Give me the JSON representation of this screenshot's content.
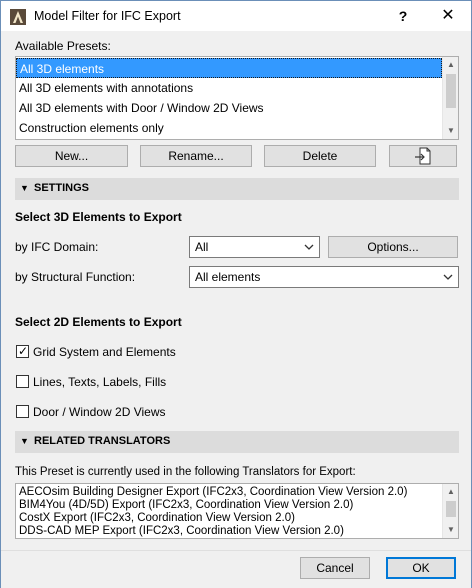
{
  "window": {
    "title": "Model Filter for IFC Export",
    "help_label": "?",
    "close_label": "✕"
  },
  "presets": {
    "label": "Available Presets:",
    "items": [
      "All 3D elements",
      "All 3D elements with annotations",
      "All 3D elements with Door / Window 2D Views",
      "Construction elements only"
    ],
    "selected_index": 0,
    "buttons": {
      "new": "New...",
      "rename": "Rename...",
      "delete": "Delete"
    }
  },
  "settings": {
    "section_title": "SETTINGS",
    "elements_3d_heading": "Select 3D Elements to Export",
    "ifc_domain_label": "by IFC Domain:",
    "ifc_domain_value": "All",
    "options_button": "Options...",
    "structural_function_label": "by Structural Function:",
    "structural_function_value": "All elements",
    "elements_2d_heading": "Select 2D Elements to Export",
    "checkboxes": [
      {
        "label": "Grid System and Elements",
        "checked": true
      },
      {
        "label": "Lines, Texts, Labels, Fills",
        "checked": false
      },
      {
        "label": "Door / Window 2D Views",
        "checked": false
      }
    ]
  },
  "related_translators": {
    "section_title": "RELATED TRANSLATORS",
    "description": "This Preset is currently used in the following Translators for Export:",
    "items": [
      "AECOsim Building Designer Export (IFC2x3, Coordination View Version 2.0)",
      "BIM4You (4D/5D) Export (IFC2x3, Coordination View Version 2.0)",
      "CostX Export (IFC2x3, Coordination View Version 2.0)",
      "DDS-CAD MEP Export (IFC2x3, Coordination View Version 2.0)"
    ]
  },
  "footer": {
    "cancel": "Cancel",
    "ok": "OK"
  },
  "colors": {
    "selection": "#3399ff",
    "button_face": "#e1e1e1",
    "section_bar": "#dcdcdc",
    "default_button_border": "#0078d7"
  }
}
